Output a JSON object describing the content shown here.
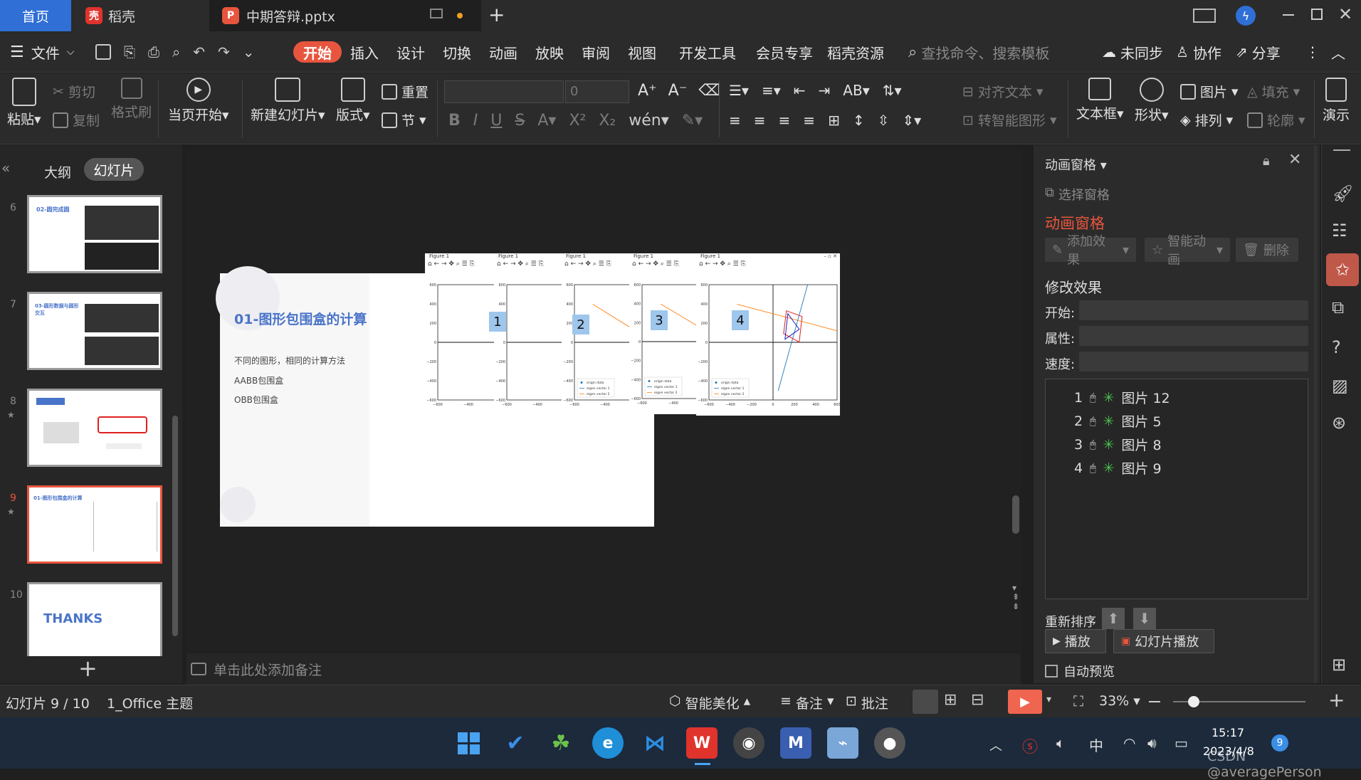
{
  "titlebar": {
    "tab_home": "首页",
    "tab_daoke": "稻壳",
    "tab_doc": "中期答辩.pptx",
    "new_tab": "+"
  },
  "menubar": {
    "file": "文件",
    "items": [
      "开始",
      "插入",
      "设计",
      "切换",
      "动画",
      "放映",
      "审阅",
      "视图",
      "开发工具",
      "会员专享",
      "稻壳资源"
    ],
    "search_placeholder": "查找命令、搜索模板",
    "sync": "未同步",
    "collab": "协作",
    "share": "分享"
  },
  "ribbon": {
    "paste": "粘贴",
    "cut": "剪切",
    "copy": "复制",
    "format_painter": "格式刷",
    "from_current": "当页开始",
    "new_slide": "新建幻灯片",
    "layout": "版式",
    "section": "节",
    "reset": "重置",
    "font_size": "0",
    "align_text": "对齐文本",
    "to_smartart": "转智能图形",
    "textbox": "文本框",
    "shape": "形状",
    "picture": "图片",
    "arrange": "排列",
    "fill": "填充",
    "outline": "轮廓",
    "present": "演示"
  },
  "left_panel": {
    "outline_tab": "大纲",
    "slides_tab": "幻灯片",
    "thumb_numbers": [
      "6",
      "7",
      "8",
      "9",
      "10"
    ],
    "thumb6_title": "02-圆完成圆",
    "thumb7_title": "03-圆形数据与圆形交互",
    "thumb9_title": "01-图形包围盒的计算",
    "thumb10_title": "THANKS",
    "add": "+"
  },
  "slide": {
    "title": "01-图形包围盒的计算",
    "lines": [
      "不同的图形，相同的计算方法",
      "AABB包围盒",
      "OBB包围盒"
    ],
    "figure_label": "Figure 1",
    "badges": [
      "1",
      "2",
      "3",
      "4"
    ],
    "y_ticks": [
      "600",
      "400",
      "200",
      "0",
      "−200",
      "−400",
      "−600"
    ],
    "x_ticks_short": [
      "−600",
      "−400",
      "−200"
    ],
    "x_ticks_full": [
      "−600",
      "−400",
      "−200",
      "0",
      "200",
      "400",
      "600"
    ],
    "legend": [
      "origin data",
      "eigen vector 1",
      "eigen vector 2"
    ]
  },
  "notes": {
    "placeholder": "单击此处添加备注"
  },
  "anim_pane": {
    "header": "动画窗格",
    "select_pane": "选择窗格",
    "title": "动画窗格",
    "add_effect": "添加效果",
    "smart_anim": "智能动画",
    "delete": "删除",
    "modify": "修改效果",
    "start": "开始:",
    "property": "属性:",
    "speed": "速度:",
    "items": [
      {
        "num": "1",
        "name": "图片 12"
      },
      {
        "num": "2",
        "name": "图片 5"
      },
      {
        "num": "3",
        "name": "图片 8"
      },
      {
        "num": "4",
        "name": "图片 9"
      }
    ],
    "reorder": "重新排序",
    "play": "播放",
    "slideshow": "幻灯片播放",
    "autopreview": "自动预览"
  },
  "status": {
    "slide_info": "幻灯片 9 / 10",
    "theme": "1_Office 主题",
    "beautify": "智能美化",
    "notes": "备注",
    "comment": "批注",
    "zoom": "33%"
  },
  "taskbar": {
    "ime": "中",
    "time": "15:17",
    "date": "2023/4/8",
    "notif": "9",
    "watermark": "CSDN @averagePerson"
  },
  "colors": {
    "accent_blue": "#2f6fd6",
    "active_tab": "#e8553e",
    "anim_title": "#e8553e",
    "slide_title": "#4a74c9",
    "play_button": "#f0654f"
  }
}
